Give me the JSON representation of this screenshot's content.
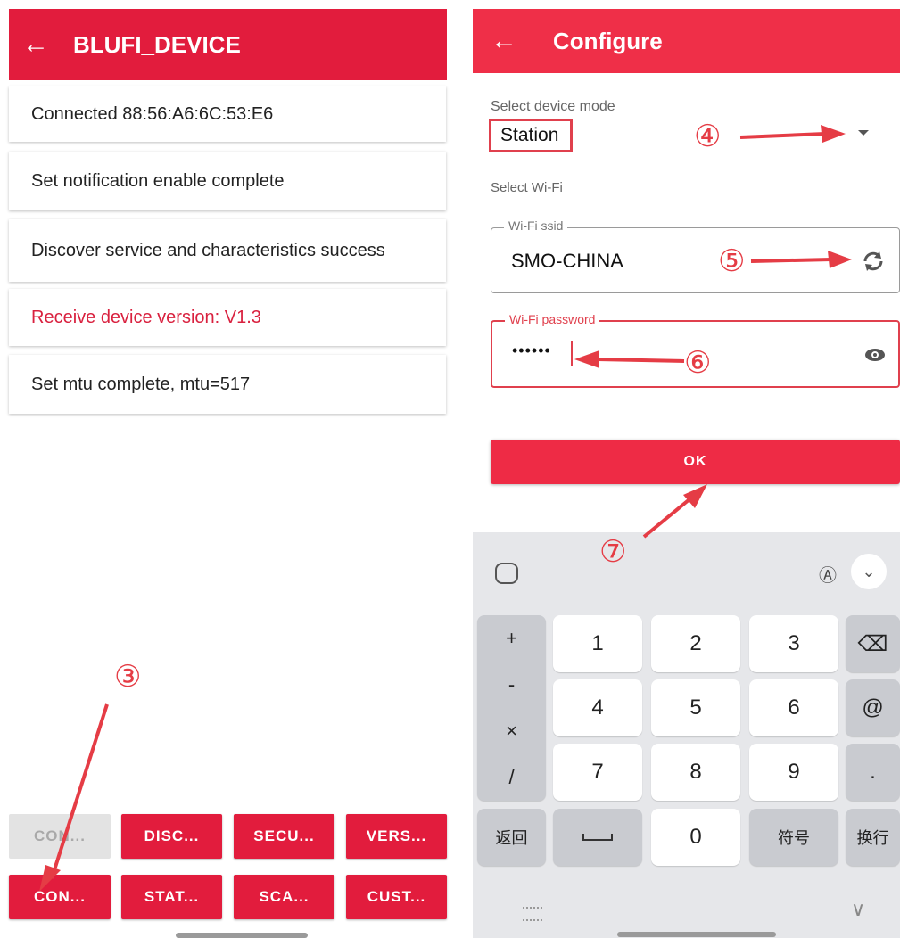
{
  "left": {
    "appbar": {
      "title": "BLUFI_DEVICE"
    },
    "log": [
      "Connected 88:56:A6:6C:53:E6",
      "Set notification enable  complete",
      "Discover service and characteristics success",
      "Receive device version: V1.3",
      "Set mtu complete, mtu=517"
    ],
    "buttons_row1": [
      "CON...",
      "DISC...",
      "SECU...",
      "VERS..."
    ],
    "buttons_row2": [
      "CON...",
      "STAT...",
      "SCA...",
      "CUST..."
    ],
    "annotation": "③"
  },
  "right": {
    "appbar": {
      "title": "Configure"
    },
    "mode_label": "Select device mode",
    "mode_value": "Station",
    "wifi_label": "Select Wi-Fi",
    "ssid_legend": "Wi-Fi ssid",
    "ssid_value": "SMO-CHINA",
    "password_legend": "Wi-Fi password",
    "password_value": "••••••",
    "ok_label": "OK",
    "annotations": {
      "mode": "④",
      "ssid": "⑤",
      "password": "⑥",
      "ok": "⑦"
    },
    "keyboard": {
      "symbols": [
        "+",
        "-",
        "×",
        "/"
      ],
      "digits": [
        "1",
        "2",
        "3",
        "4",
        "5",
        "6",
        "7",
        "8",
        "9",
        "0"
      ],
      "right_keys": [
        "⌫",
        "@",
        "."
      ],
      "bottom": {
        "back": "返回",
        "symbols": "符号",
        "enter": "换行"
      }
    }
  }
}
